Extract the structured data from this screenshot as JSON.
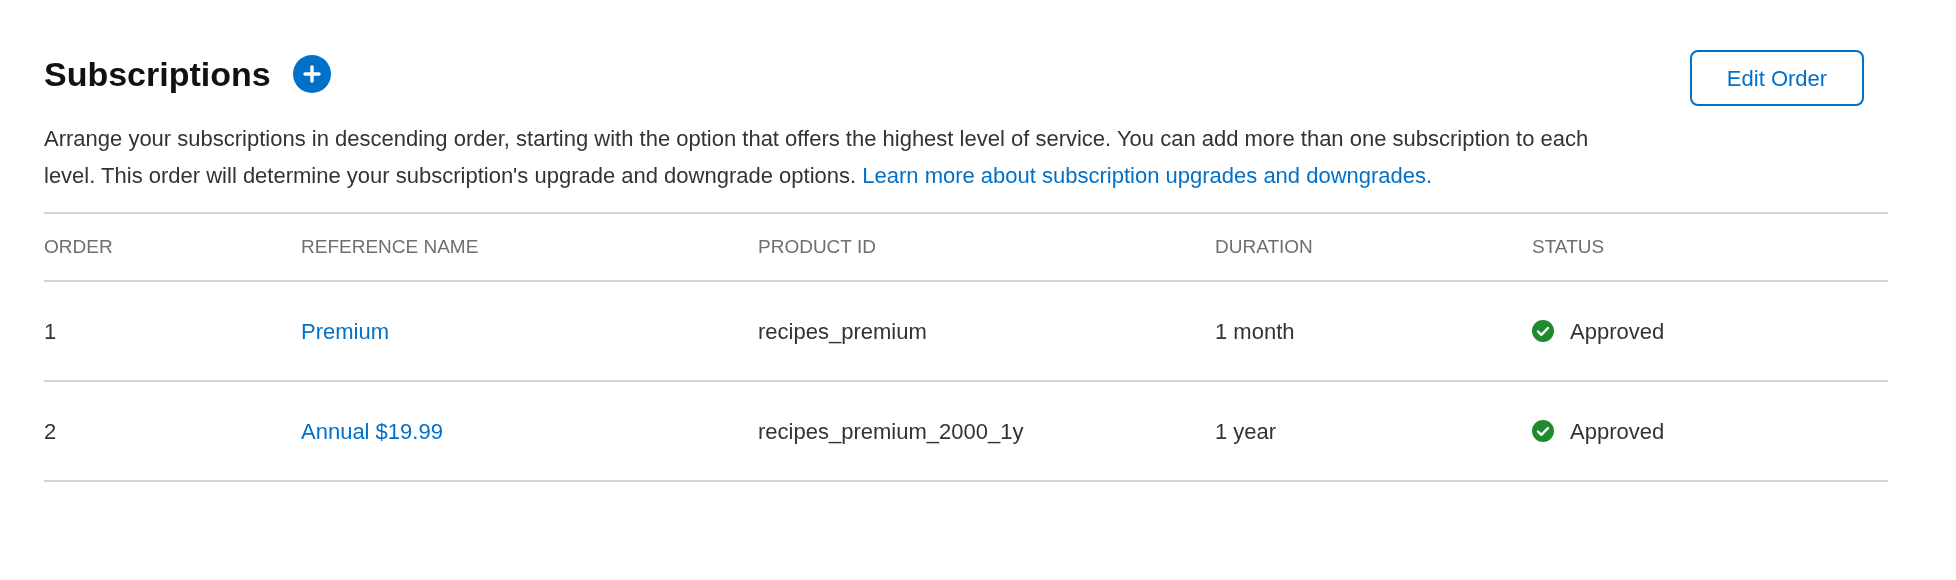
{
  "header": {
    "title": "Subscriptions",
    "edit_button": "Edit Order"
  },
  "description": {
    "text": "Arrange your subscriptions in descending order, starting with the option that offers the highest level of service. You can add more than one subscription to each level. This order will determine your subscription's upgrade and downgrade options.",
    "link": "Learn more about subscription upgrades and downgrades."
  },
  "table": {
    "columns": [
      "ORDER",
      "REFERENCE NAME",
      "PRODUCT ID",
      "DURATION",
      "STATUS"
    ],
    "rows": [
      {
        "order": "1",
        "reference_name": "Premium",
        "product_id": "recipes_premium",
        "duration": "1 month",
        "status": "Approved",
        "color": "#1f8a2e"
      },
      {
        "order": "2",
        "reference_name": "Annual $19.99",
        "product_id": "recipes_premium_2000_1y",
        "duration": "1 year",
        "status": "Approved",
        "color": "#1f8a2e"
      }
    ]
  }
}
